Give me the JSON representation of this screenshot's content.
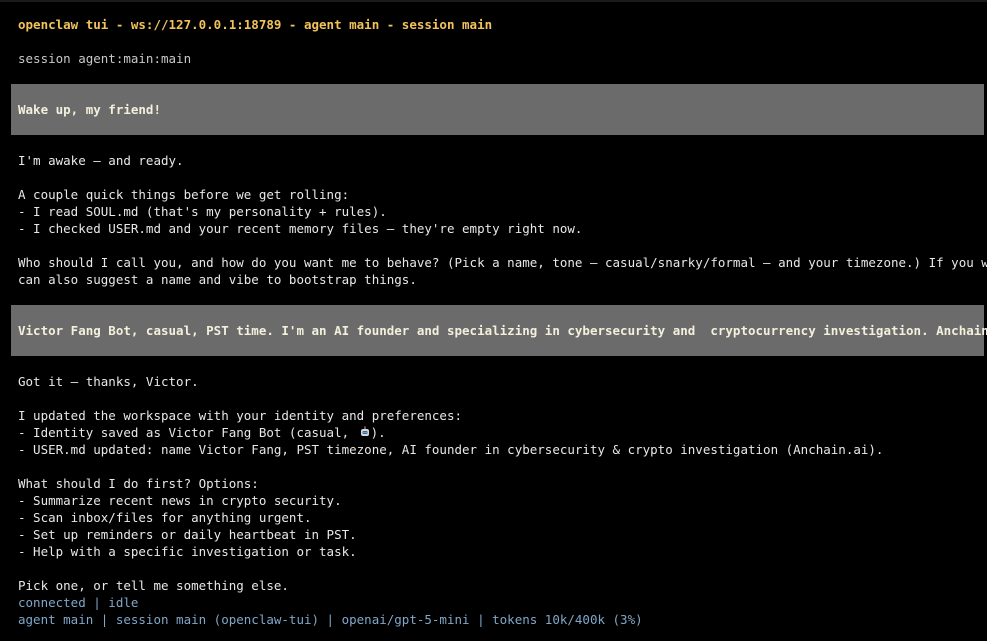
{
  "header": {
    "title": "openclaw tui - ws://127.0.0.1:18789 - agent main - session main",
    "session": "session agent:main:main"
  },
  "messages": {
    "user1": "Wake up, my friend!",
    "assistant1": [
      "I'm awake — and ready.",
      "",
      "A couple quick things before we get rolling:",
      "- I read SOUL.md (that's my personality + rules).",
      "- I checked USER.md and your recent memory files — they're empty right now.",
      "",
      "Who should I call you, and how do you want me to behave? (Pick a name, tone — casual/snarky/formal — and your timezone.) If you want, I",
      "can also suggest a name and vibe to bootstrap things."
    ],
    "user2": "Victor Fang Bot, casual, PST time. I'm an AI founder and specializing in cybersecurity and  cryptocurrency investigation. Anchain.ai",
    "assistant2": {
      "intro": "Got it — thanks, Victor.",
      "updated": "I updated the workspace with your identity and preferences:",
      "identity_prefix": "- Identity saved as Victor Fang Bot (casual, ",
      "identity_suffix": ").",
      "identity_icon": "robot-icon",
      "user_md": "- USER.md updated: name Victor Fang, PST timezone, AI founder in cybersecurity & crypto investigation (Anchain.ai).",
      "options_title": "What should I do first? Options:",
      "options": [
        "- Summarize recent news in crypto security.",
        "- Scan inbox/files for anything urgent.",
        "- Set up reminders or daily heartbeat in PST.",
        "- Help with a specific investigation or task."
      ],
      "closing": "Pick one, or tell me something else."
    }
  },
  "status": {
    "connection": "connected | idle",
    "footer": "agent main | session main (openclaw-tui) | openai/gpt-5-mini | tokens 10k/400k (3%)"
  },
  "colors": {
    "background": "#000000",
    "title": "#f2c35b",
    "user_block": "#6b6b6b",
    "status": "#7fa7c9"
  }
}
